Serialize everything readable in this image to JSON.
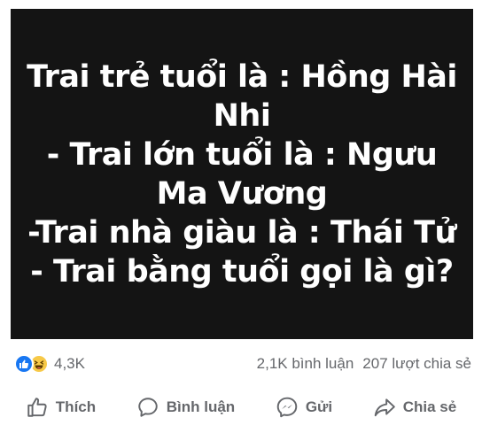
{
  "post": {
    "lines": [
      "Trai trẻ tuổi là : Hồng Hài",
      "Nhi",
      "- Trai lớn tuổi là : Ngưu",
      "Ma Vương",
      "-Trai nhà giàu là : Thái Tử",
      "- Trai bằng tuổi gọi là gì?"
    ]
  },
  "stats": {
    "reaction_count": "4,3K",
    "comment_count": "2,1K bình luận",
    "share_count": "207 lượt chia sẻ",
    "reaction_icons": [
      "like-icon",
      "haha-icon"
    ]
  },
  "actions": {
    "like_label": "Thích",
    "comment_label": "Bình luận",
    "send_label": "Gửi",
    "share_label": "Chia sẻ"
  },
  "colors": {
    "image_background": "#141414",
    "like_blue": "#1877f2",
    "haha_yellow": "#f7c948",
    "secondary_text": "#65676b"
  }
}
